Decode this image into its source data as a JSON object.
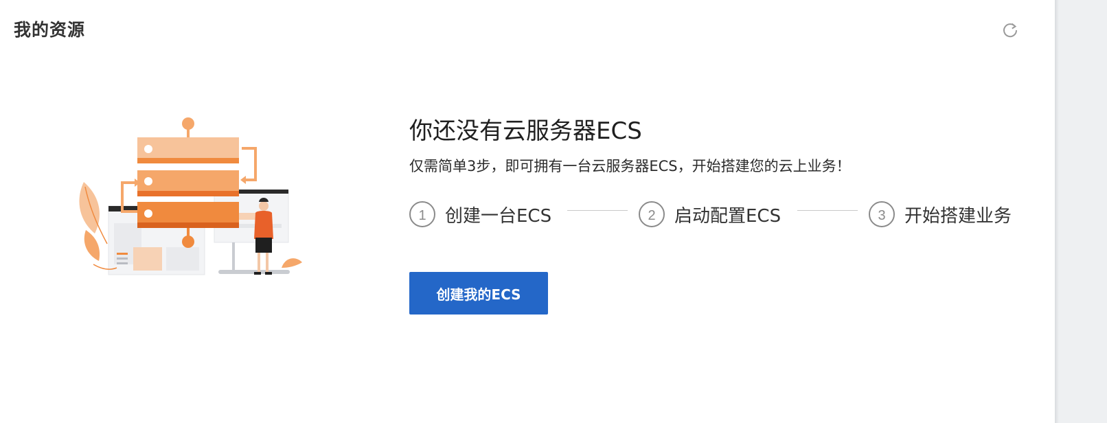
{
  "header": {
    "title": "我的资源",
    "refresh_icon": "refresh-icon"
  },
  "empty_state": {
    "title": "你还没有云服务器ECS",
    "description": "仅需简单3步，即可拥有一台云服务器ECS，开始搭建您的云上业务！",
    "steps": [
      {
        "number": "1",
        "label": "创建一台ECS"
      },
      {
        "number": "2",
        "label": "启动配置ECS"
      },
      {
        "number": "3",
        "label": "开始搭建业务"
      }
    ],
    "button_label": "创建我的ECS"
  },
  "colors": {
    "primary_button": "#2467c8",
    "illustration_orange": "#f08a3e",
    "illustration_light_orange": "#f7c39a"
  }
}
